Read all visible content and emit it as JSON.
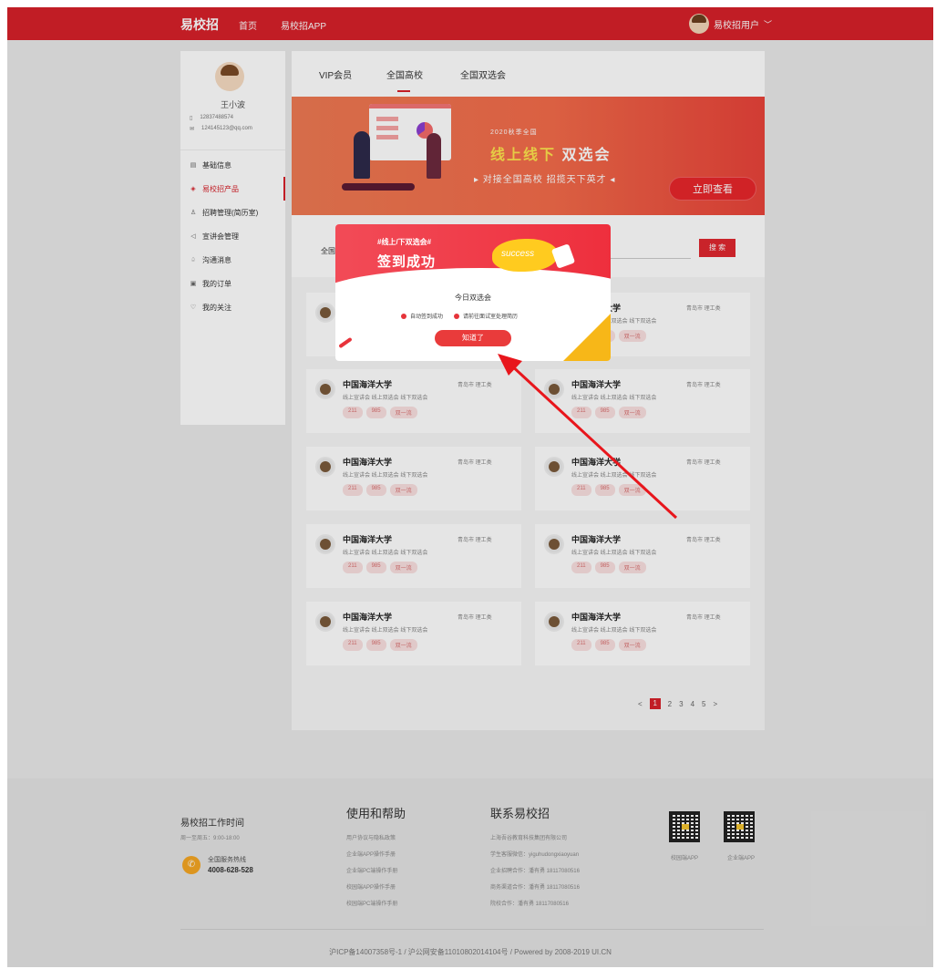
{
  "topbar": {
    "brand": "易校招",
    "nav": [
      "首页",
      "易校招APP"
    ],
    "user_label": "易校招用户"
  },
  "sidebar": {
    "name": "王小波",
    "phone": "12837488574",
    "email": "124145123@qq.com",
    "items": [
      {
        "label": "基础信息",
        "icon": "id-card-icon"
      },
      {
        "label": "易校招产品",
        "icon": "box-icon"
      },
      {
        "label": "招聘管理(简历室)",
        "icon": "user-icon"
      },
      {
        "label": "宣讲会管理",
        "icon": "speaker-icon"
      },
      {
        "label": "沟通消息",
        "icon": "bell-icon"
      },
      {
        "label": "我的订单",
        "icon": "order-icon"
      },
      {
        "label": "我的关注",
        "icon": "heart-icon"
      }
    ]
  },
  "tabs": [
    "VIP会员",
    "全国高校",
    "全国双选会"
  ],
  "banner": {
    "year": "2020秋季全国",
    "title_a": "线上线下",
    "title_b": "双选会",
    "subtitle": "▸ 对接全国高校 招揽天下英才 ◂",
    "button": "立即查看"
  },
  "search": {
    "label": "全国",
    "button": "搜 索"
  },
  "cards": [
    {
      "name": "中国海洋大学",
      "loc": "青岛市  理工类",
      "tags": "线上宣讲会  线上双选会  线下双选会",
      "pills": [
        "211",
        "985",
        "双一流"
      ]
    },
    {
      "name": "中国海洋大学",
      "loc": "青岛市  理工类",
      "tags": "线上宣讲会  线上双选会  线下双选会",
      "pills": [
        "211",
        "985",
        "双一流"
      ]
    }
  ],
  "pager": {
    "prev": "<",
    "pages": [
      "1",
      "2",
      "3",
      "4",
      "5"
    ],
    "next": ">"
  },
  "modal": {
    "tag": "#线上/下双选会#",
    "title": "签到成功",
    "badge": "success",
    "subtitle": "今日双选会",
    "item1": "自动签到成功",
    "item2": "请前往面试室处理简历",
    "button": "知道了"
  },
  "footer": {
    "work_title": "易校招工作时间",
    "work_hours": "周一至周五：9:00-18:00",
    "hotline_label": "全国服务热线",
    "hotline": "4008-628-528",
    "help_title": "使用和帮助",
    "help_links": [
      "用户协议与隐私政策",
      "企业端APP操作手册",
      "企业端PC端操作手册",
      "校园端APP操作手册",
      "校园端PC端操作手册"
    ],
    "contact_title": "联系易校招",
    "contact_lines": [
      "上海吾谷教育科技集团有限公司",
      "学生客服微信：yiguhudongxiaoyuan",
      "企业招聘合作：潘有勇 18117080516",
      "商务渠道合作：潘有勇 18117080516",
      "院校合作：潘有勇 18117080516"
    ],
    "qr1_label": "校园端APP",
    "qr2_label": "企业端APP",
    "copyright": "沪ICP备14007358号-1 / 沪公网安备11010802014104号 / Powered by 2008-2019 UI.CN"
  }
}
